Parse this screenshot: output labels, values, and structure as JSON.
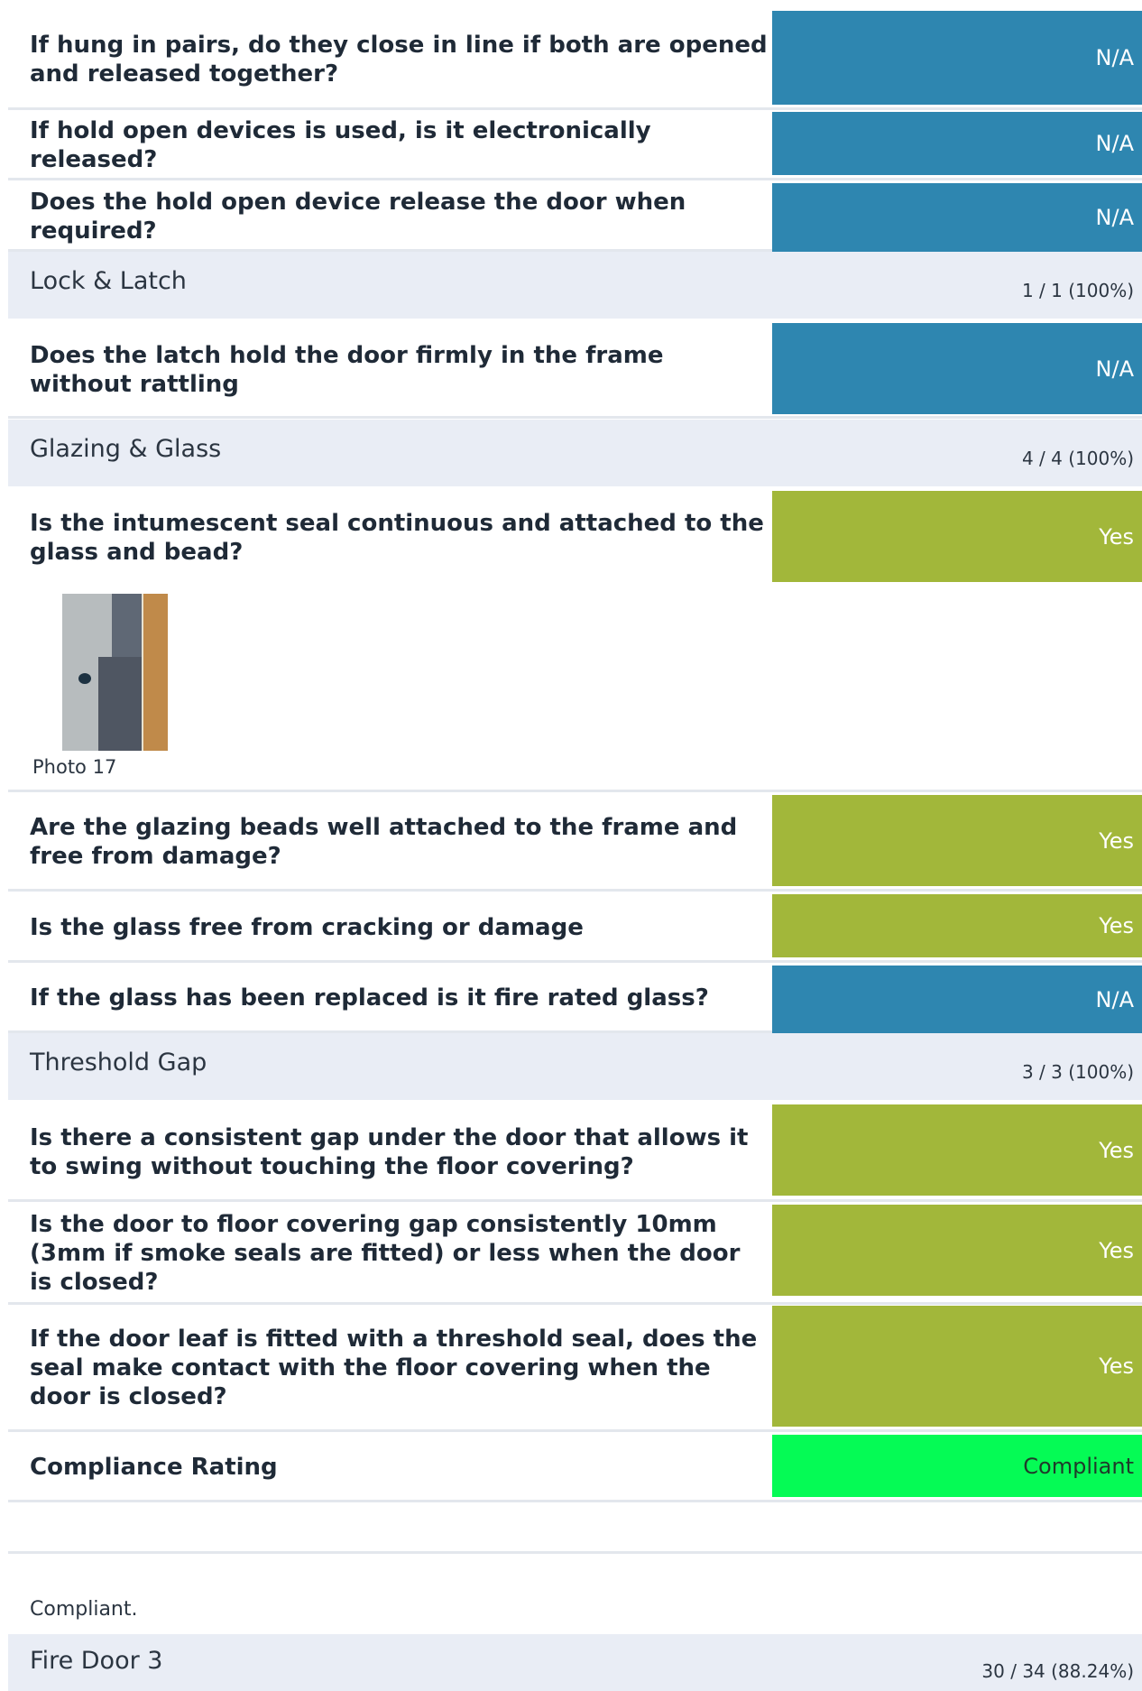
{
  "questions": {
    "q1": {
      "text": "If hung in pairs, do they close in line if both are opened and released together?",
      "answer": "N/A"
    },
    "q2": {
      "text": "If hold open devices is used, is it electronically released?",
      "answer": "N/A"
    },
    "q3": {
      "text": "Does the hold open device release the door when required?",
      "answer": "N/A"
    },
    "q4": {
      "text": "Does the latch hold the door firmly in the frame without rattling",
      "answer": "N/A"
    },
    "q5": {
      "text": "Is the intumescent seal continuous and attached to the glass and bead?",
      "answer": "Yes"
    },
    "q6": {
      "text": "Are the glazing beads well attached to the frame and free from damage?",
      "answer": "Yes"
    },
    "q7": {
      "text": "Is the glass free from cracking or damage",
      "answer": "Yes"
    },
    "q8": {
      "text": "If the glass has been replaced is it fire rated glass?",
      "answer": "N/A"
    },
    "q9": {
      "text": "Is there a consistent gap under the door that allows it to swing without touching the floor covering?",
      "answer": "Yes"
    },
    "q10": {
      "text": "Is the door to floor covering gap consistently 10mm (3mm if smoke seals are fitted) or less when the door is closed?",
      "answer": "Yes"
    },
    "q11": {
      "text": "If the door leaf is fitted with a threshold seal, does the seal make contact with the floor covering when the door is closed?",
      "answer": "Yes"
    }
  },
  "sections": {
    "lock_latch": {
      "title": "Lock & Latch",
      "score": "1 / 1 (100%)"
    },
    "glazing": {
      "title": "Glazing & Glass",
      "score": "4 / 4 (100%)"
    },
    "threshold": {
      "title": "Threshold Gap",
      "score": "3 / 3 (100%)"
    },
    "fire_door_3": {
      "title": "Fire Door 3",
      "score": "30 / 34 (88.24%)"
    }
  },
  "photo": {
    "caption": "Photo 17"
  },
  "compliance": {
    "label": "Compliance Rating",
    "value": "Compliant"
  },
  "note": "Compliant.",
  "colors": {
    "na": "#2e86b0",
    "yes": "#a2b73a",
    "compliant": "#05fb55",
    "section_bg": "#e9edf5"
  }
}
